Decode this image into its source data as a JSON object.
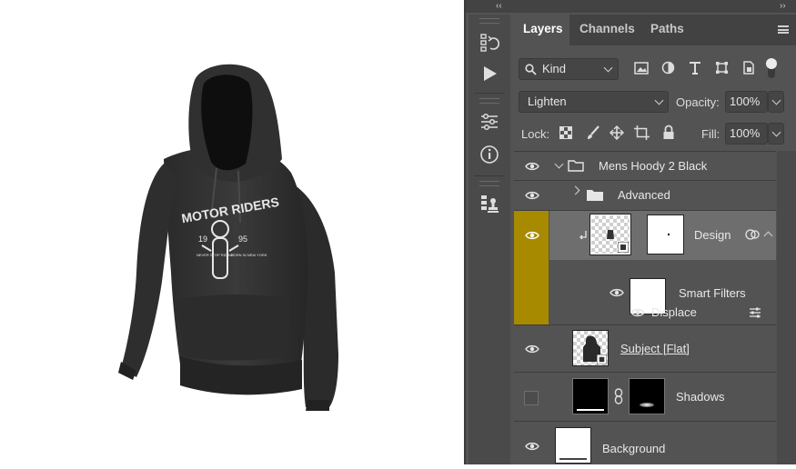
{
  "panel_tabs": [
    "Layers",
    "Channels",
    "Paths"
  ],
  "filter": {
    "label": "Kind"
  },
  "blend": {
    "mode": "Lighten",
    "opacity_label": "Opacity:",
    "opacity_value": "100%"
  },
  "lock": {
    "label": "Lock:",
    "fill_label": "Fill:",
    "fill_value": "100%"
  },
  "layers": {
    "group": "Mens Hoody 2 Black",
    "advanced": "Advanced",
    "design": "Design",
    "smart_filters": "Smart Filters",
    "displace": "Displace",
    "subject": "Subject [Flat]",
    "shadows": "Shadows",
    "background": "Background"
  },
  "artwork": {
    "title": "MOTOR RIDERS",
    "year_left": "19",
    "year_right": "95",
    "left_text": "NEVER STOP RIDING",
    "right_text": "BORN IN NEW YORK"
  },
  "colors": {
    "selection": "#a88a00",
    "panel": "#535353"
  },
  "icons": [
    "history-icon",
    "play-icon",
    "adjustments-icon",
    "info-icon",
    "clone-source-icon",
    "search-icon",
    "image-filter-icon",
    "adjustment-filter-icon",
    "type-filter-icon",
    "shape-filter-icon",
    "smart-object-filter-icon",
    "eye-icon",
    "folder-icon",
    "lock-icon",
    "link-icon"
  ]
}
